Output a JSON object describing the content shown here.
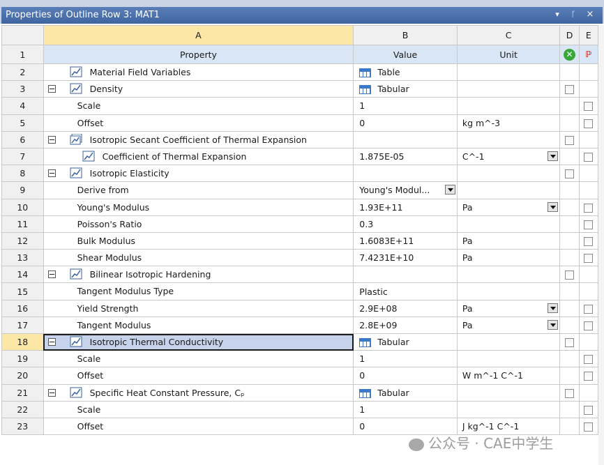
{
  "panel": {
    "title": "Properties of Outline Row 3: MAT1"
  },
  "columns": {
    "rn": "",
    "a": "A",
    "b": "B",
    "c": "C",
    "d": "D",
    "e": "E"
  },
  "subheader": {
    "num": "1",
    "property": "Property",
    "value": "Value",
    "unit": "Unit"
  },
  "rows": [
    {
      "num": "2",
      "prop": "Material Field Variables",
      "indent": 1,
      "expand": false,
      "icon": "chart-icon",
      "value": "Table",
      "vicon": true,
      "unit": "",
      "dropdown": false,
      "d": false,
      "e": false
    },
    {
      "num": "3",
      "prop": "Density",
      "indent": 1,
      "expand": true,
      "icon": "chart-icon",
      "value": "Tabular",
      "vicon": true,
      "unit": "",
      "dropdown": false,
      "d": true,
      "e": false
    },
    {
      "num": "4",
      "prop": "Scale",
      "indent": 2,
      "expand": false,
      "icon": "",
      "value": "1",
      "vicon": false,
      "unit": "",
      "dropdown": false,
      "d": false,
      "e": true
    },
    {
      "num": "5",
      "prop": "Offset",
      "indent": 2,
      "expand": false,
      "icon": "",
      "value": "0",
      "vicon": false,
      "unit": "kg m^-3",
      "dropdown": false,
      "d": false,
      "e": true
    },
    {
      "num": "6",
      "prop": "Isotropic Secant Coefficient of Thermal Expansion",
      "indent": 1,
      "expand": true,
      "icon": "multi-chart-icon",
      "value": "",
      "vicon": false,
      "unit": "",
      "dropdown": false,
      "d": true,
      "e": false
    },
    {
      "num": "7",
      "prop": "Coefficient of Thermal Expansion",
      "indent": 3,
      "expand": false,
      "icon": "chart-icon",
      "value": "1.875E-05",
      "vicon": false,
      "unit": "C^-1",
      "dropdown": true,
      "d": false,
      "e": true
    },
    {
      "num": "8",
      "prop": "Isotropic Elasticity",
      "indent": 1,
      "expand": true,
      "icon": "chart-icon",
      "value": "",
      "vicon": false,
      "unit": "",
      "dropdown": false,
      "d": true,
      "e": false
    },
    {
      "num": "9",
      "prop": "Derive from",
      "indent": 2,
      "expand": false,
      "icon": "",
      "value": "Young's Modul...",
      "vicon": false,
      "vdrop": true,
      "unit": "",
      "dropdown": false,
      "d": false,
      "e": false
    },
    {
      "num": "10",
      "prop": "Young's Modulus",
      "indent": 2,
      "expand": false,
      "icon": "",
      "value": "1.93E+11",
      "vicon": false,
      "unit": "Pa",
      "dropdown": true,
      "d": false,
      "e": true
    },
    {
      "num": "11",
      "prop": "Poisson's Ratio",
      "indent": 2,
      "expand": false,
      "icon": "",
      "value": "0.3",
      "vicon": false,
      "unit": "",
      "dropdown": false,
      "d": false,
      "e": true
    },
    {
      "num": "12",
      "prop": "Bulk Modulus",
      "indent": 2,
      "expand": false,
      "icon": "",
      "value": "1.6083E+11",
      "vicon": false,
      "unit": "Pa",
      "dropdown": false,
      "d": false,
      "e": true
    },
    {
      "num": "13",
      "prop": "Shear Modulus",
      "indent": 2,
      "expand": false,
      "icon": "",
      "value": "7.4231E+10",
      "vicon": false,
      "unit": "Pa",
      "dropdown": false,
      "d": false,
      "e": true
    },
    {
      "num": "14",
      "prop": "Bilinear Isotropic Hardening",
      "indent": 1,
      "expand": true,
      "icon": "chart-icon",
      "value": "",
      "vicon": false,
      "unit": "",
      "dropdown": false,
      "d": true,
      "e": false
    },
    {
      "num": "15",
      "prop": "Tangent Modulus Type",
      "indent": 2,
      "expand": false,
      "icon": "",
      "value": "Plastic",
      "vicon": false,
      "unit": "",
      "dropdown": false,
      "d": false,
      "e": false
    },
    {
      "num": "16",
      "prop": "Yield Strength",
      "indent": 2,
      "expand": false,
      "icon": "",
      "value": "2.9E+08",
      "vicon": false,
      "unit": "Pa",
      "dropdown": true,
      "d": false,
      "e": true
    },
    {
      "num": "17",
      "prop": "Tangent Modulus",
      "indent": 2,
      "expand": false,
      "icon": "",
      "value": "2.8E+09",
      "vicon": false,
      "unit": "Pa",
      "dropdown": true,
      "d": false,
      "e": true
    },
    {
      "num": "18",
      "prop": "Isotropic Thermal Conductivity",
      "indent": 1,
      "expand": true,
      "icon": "chart-icon",
      "value": "Tabular",
      "vicon": true,
      "unit": "",
      "dropdown": false,
      "d": true,
      "e": false,
      "selected": true
    },
    {
      "num": "19",
      "prop": "Scale",
      "indent": 2,
      "expand": false,
      "icon": "",
      "value": "1",
      "vicon": false,
      "unit": "",
      "dropdown": false,
      "d": false,
      "e": true
    },
    {
      "num": "20",
      "prop": "Offset",
      "indent": 2,
      "expand": false,
      "icon": "",
      "value": "0",
      "vicon": false,
      "unit": "W m^-1 C^-1",
      "dropdown": false,
      "d": false,
      "e": true
    },
    {
      "num": "21",
      "prop": "Specific Heat Constant Pressure, Cₚ",
      "indent": 1,
      "expand": true,
      "icon": "chart-icon",
      "value": "Tabular",
      "vicon": true,
      "unit": "",
      "dropdown": false,
      "d": true,
      "e": false
    },
    {
      "num": "22",
      "prop": "Scale",
      "indent": 2,
      "expand": false,
      "icon": "",
      "value": "1",
      "vicon": false,
      "unit": "",
      "dropdown": false,
      "d": false,
      "e": true
    },
    {
      "num": "23",
      "prop": "Offset",
      "indent": 2,
      "expand": false,
      "icon": "",
      "value": "0",
      "vicon": false,
      "unit": "J kg^-1 C^-1",
      "dropdown": false,
      "d": false,
      "e": true
    }
  ],
  "watermark": {
    "text": "公众号 · CAE中学生"
  }
}
